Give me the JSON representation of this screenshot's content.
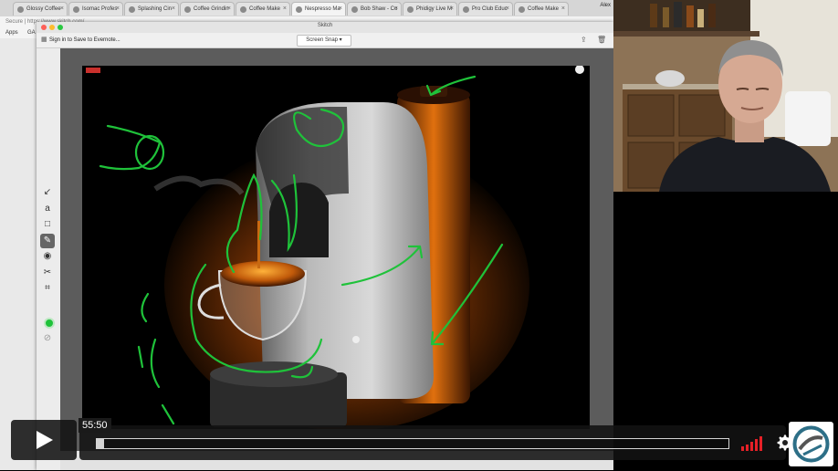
{
  "browser": {
    "tabs": [
      {
        "label": "Glossy Coffee"
      },
      {
        "label": "Isomac Profes"
      },
      {
        "label": "Splashing Cin"
      },
      {
        "label": "Coffee Grindin"
      },
      {
        "label": "Coffee Make"
      },
      {
        "label": "Nespresso Ma"
      },
      {
        "label": "Bob Shaw - Co"
      },
      {
        "label": "Phidigy Live M"
      },
      {
        "label": "Pro Club Educ"
      },
      {
        "label": "Coffee Make"
      }
    ],
    "user": "Alex",
    "address": "Secure | https://www.skitch.com/...",
    "bookmarks": [
      "Apps",
      "GA"
    ]
  },
  "skitch": {
    "title": "Skitch",
    "evernote_label": "Sign in to Save to Evernote...",
    "snap_label": "Screen Snap",
    "tools": [
      {
        "icon": "arrow-icon",
        "glyph": "↙"
      },
      {
        "icon": "text-icon",
        "glyph": "a"
      },
      {
        "icon": "rectangle-icon",
        "glyph": "□"
      },
      {
        "icon": "pen-icon",
        "glyph": "✎"
      },
      {
        "icon": "pixelate-icon",
        "glyph": "◉"
      },
      {
        "icon": "crop-icon",
        "glyph": "✂"
      },
      {
        "icon": "resize-icon",
        "glyph": "⌗"
      }
    ],
    "active_tool": "pen-icon",
    "annotation_color": "#1fc23a"
  },
  "player": {
    "time": "55:50",
    "progress": 0.012,
    "accent": "#e62027"
  }
}
